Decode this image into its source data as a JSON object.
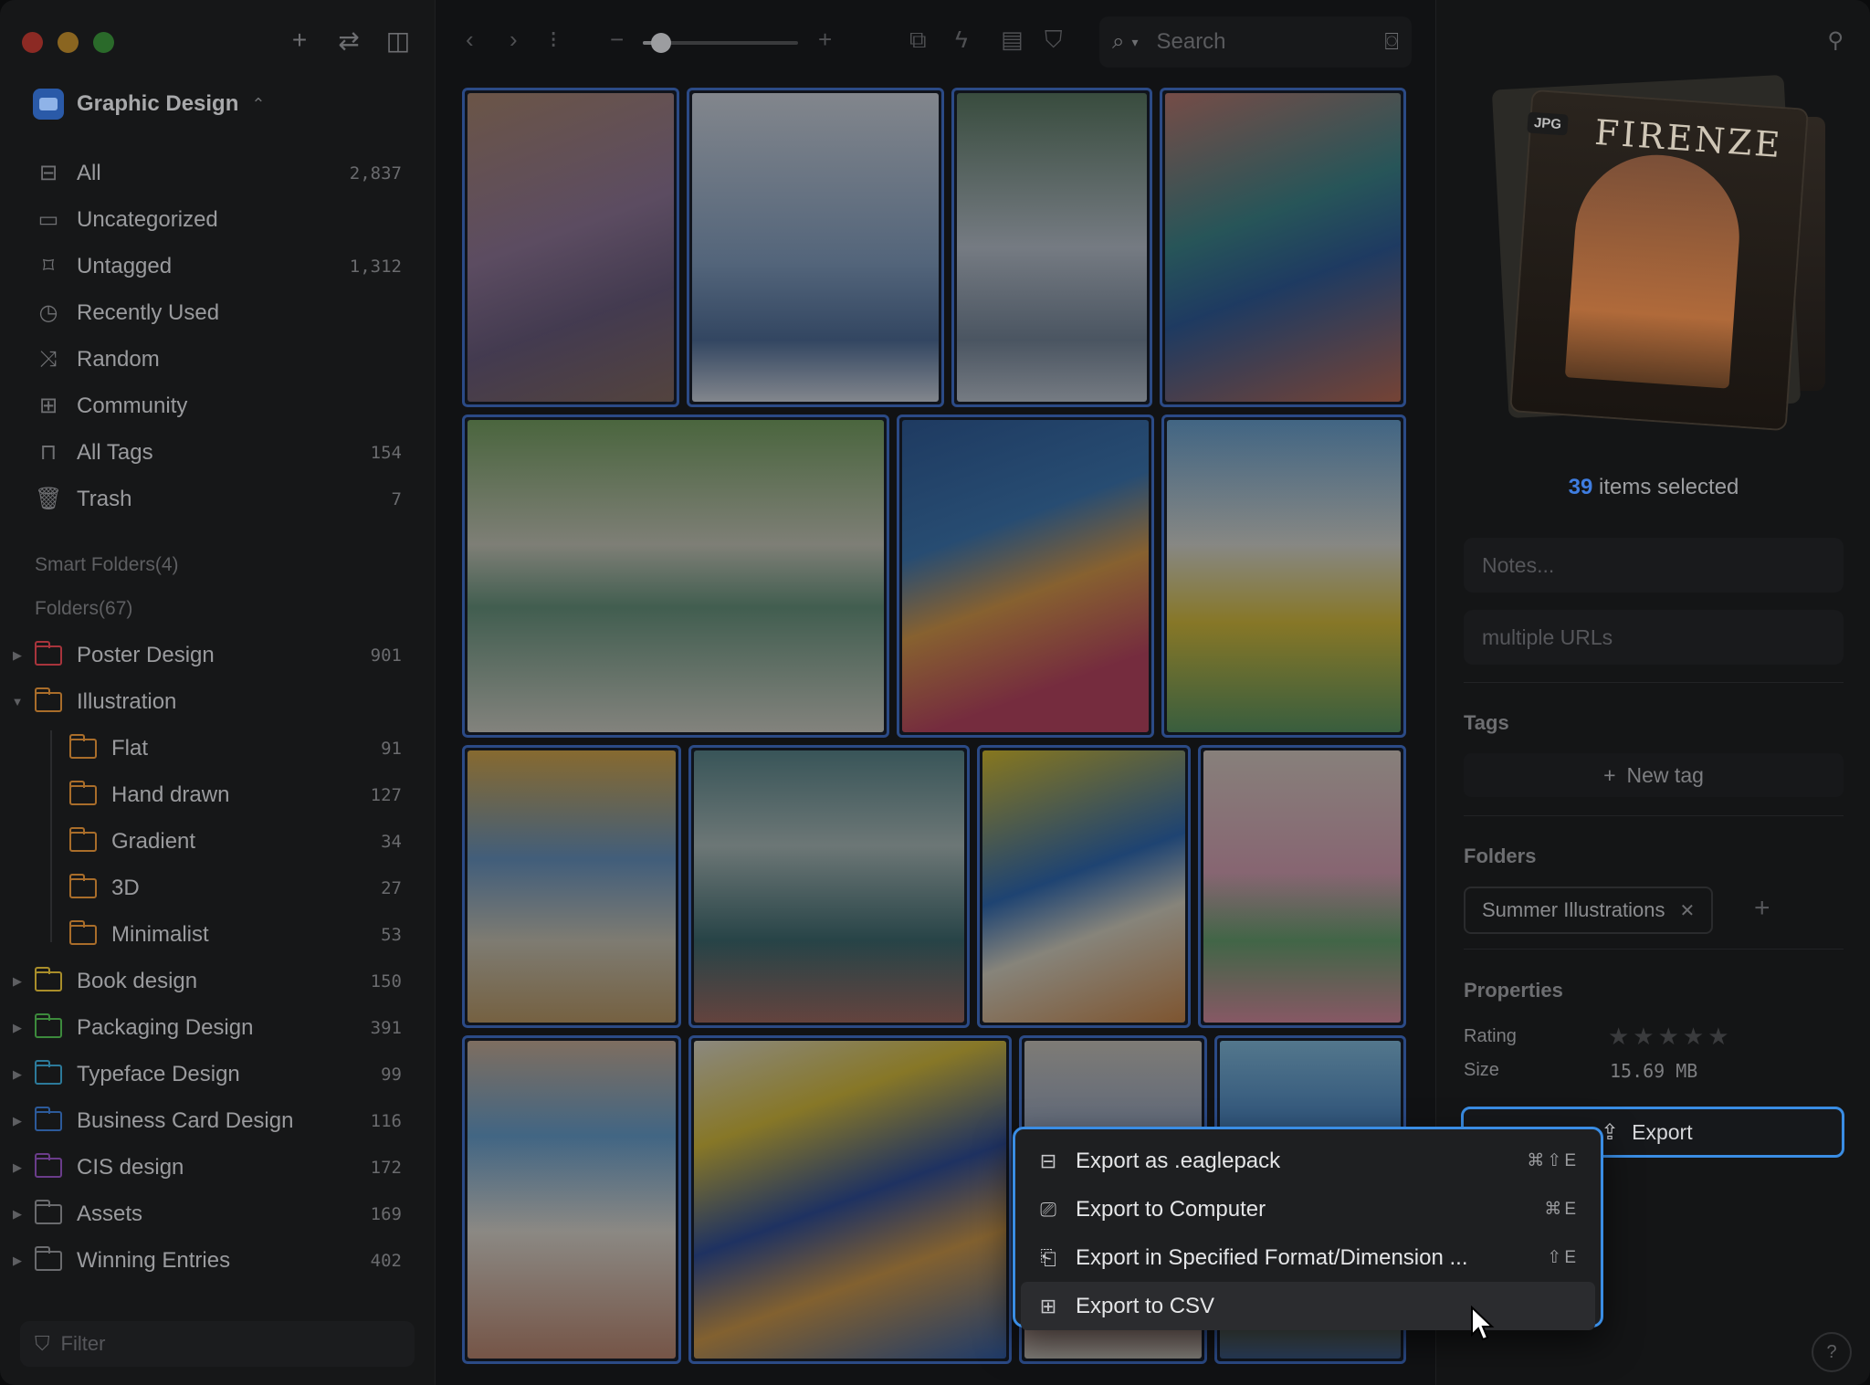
{
  "sidebar": {
    "library_name": "Graphic Design",
    "nav": [
      {
        "label": "All",
        "count": "2,837",
        "icon": "inbox-icon"
      },
      {
        "label": "Uncategorized",
        "count": "",
        "icon": "folder-question-icon"
      },
      {
        "label": "Untagged",
        "count": "1,312",
        "icon": "tag-question-icon"
      },
      {
        "label": "Recently Used",
        "count": "",
        "icon": "clock-icon"
      },
      {
        "label": "Random",
        "count": "",
        "icon": "shuffle-icon"
      },
      {
        "label": "Community",
        "count": "",
        "icon": "archive-icon"
      },
      {
        "label": "All Tags",
        "count": "154",
        "icon": "bookmark-icon"
      },
      {
        "label": "Trash",
        "count": "7",
        "icon": "trash-icon"
      }
    ],
    "smart_folders_label": "Smart Folders(4)",
    "folders_label": "Folders(67)",
    "folders": [
      {
        "label": "Poster Design",
        "count": "901",
        "color": "#a8343c",
        "toggle": "▶",
        "child": false
      },
      {
        "label": "Illustration",
        "count": "",
        "color": "#a96d2a",
        "toggle": "▼",
        "child": false
      },
      {
        "label": "Flat",
        "count": "91",
        "color": "#a96d2a",
        "toggle": "",
        "child": true
      },
      {
        "label": "Hand drawn",
        "count": "127",
        "color": "#a96d2a",
        "toggle": "",
        "child": true
      },
      {
        "label": "Gradient",
        "count": "34",
        "color": "#a96d2a",
        "toggle": "",
        "child": true
      },
      {
        "label": "3D",
        "count": "27",
        "color": "#a96d2a",
        "toggle": "",
        "child": true
      },
      {
        "label": "Minimalist",
        "count": "53",
        "color": "#a96d2a",
        "toggle": "",
        "child": true
      },
      {
        "label": "Book design",
        "count": "150",
        "color": "#a98e2a",
        "toggle": "▶",
        "child": false
      },
      {
        "label": "Packaging Design",
        "count": "391",
        "color": "#3c8a3c",
        "toggle": "▶",
        "child": false
      },
      {
        "label": "Typeface Design",
        "count": "99",
        "color": "#2c7a9a",
        "toggle": "▶",
        "child": false
      },
      {
        "label": "Business Card Design",
        "count": "116",
        "color": "#2c5a9a",
        "toggle": "▶",
        "child": false
      },
      {
        "label": "CIS design",
        "count": "172",
        "color": "#6a3c8a",
        "toggle": "▶",
        "child": false
      },
      {
        "label": "Assets",
        "count": "169",
        "color": "#6a6b6e",
        "toggle": "▶",
        "child": false
      },
      {
        "label": "Winning Entries",
        "count": "402",
        "color": "#6a6b6e",
        "toggle": "▶",
        "child": false
      }
    ],
    "filter_placeholder": "Filter"
  },
  "toolbar": {
    "search_placeholder": "Search",
    "zoom_level": 0.12
  },
  "inspector": {
    "file_type_badge": "JPG",
    "poster_title": "FIRENZE",
    "selected_count": "39",
    "selected_label": "items selected",
    "notes_placeholder": "Notes...",
    "urls_placeholder": "multiple URLs",
    "tags_heading": "Tags",
    "new_tag_label": "New tag",
    "folders_heading": "Folders",
    "folder_chip": "Summer Illustrations",
    "properties_heading": "Properties",
    "rating_label": "Rating",
    "rating_stars": "★★★★★",
    "size_label": "Size",
    "size_value": "15.69 MB",
    "export_label": "Export"
  },
  "context_menu": {
    "items": [
      {
        "label": "Export as .eaglepack",
        "shortcut": "⌘⇧E",
        "icon": "package-icon"
      },
      {
        "label": "Export to Computer",
        "shortcut": "⌘E",
        "icon": "computer-icon"
      },
      {
        "label": "Export in Specified Format/Dimension ...",
        "shortcut": "⇧E",
        "icon": "export-format-icon"
      },
      {
        "label": "Export to CSV",
        "shortcut": "",
        "icon": "csv-icon"
      }
    ]
  },
  "colors": {
    "accent": "#3a8de4",
    "selection_border": "#2b4a86"
  }
}
